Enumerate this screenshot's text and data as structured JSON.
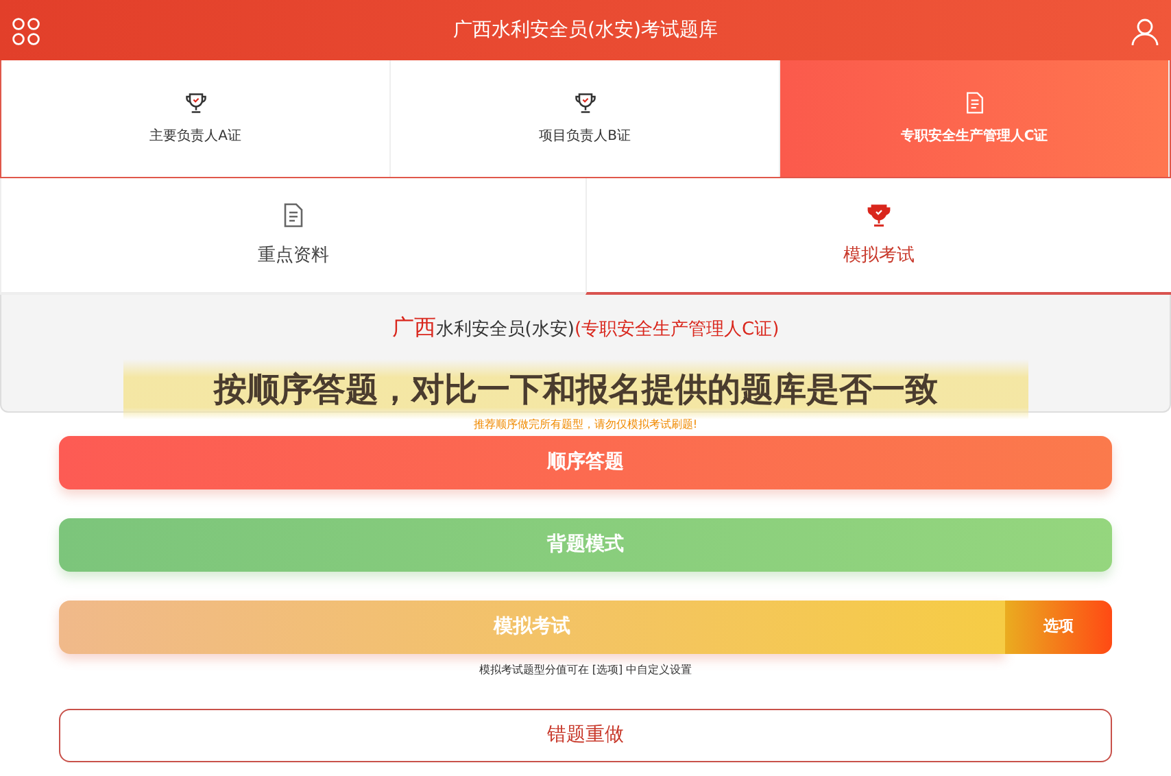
{
  "header": {
    "title": "广西水利安全员(水安)考试题库"
  },
  "cert_tabs": [
    {
      "label": "主要负责人A证",
      "kind": "trophy",
      "selected": false
    },
    {
      "label": "项目负责人B证",
      "kind": "trophy",
      "selected": false
    },
    {
      "label": "专职安全生产管理人C证",
      "kind": "doc",
      "selected": true
    }
  ],
  "section_tabs": [
    {
      "label": "重点资料",
      "kind": "doc",
      "selected": false
    },
    {
      "label": "模拟考试",
      "kind": "trophy",
      "selected": true
    }
  ],
  "info": {
    "parts": [
      {
        "text": "广西",
        "kind": "region"
      },
      {
        "text": "水利安全员(水安)",
        "kind": "plain"
      },
      {
        "text": "(专职安全生产管理人C证)",
        "kind": "cert"
      }
    ]
  },
  "annotation": "按顺序答题，对比一下和报名提供的题库是否一致",
  "hint": "推荐顺序做完所有题型，请勿仅模拟考试刷题!",
  "actions": [
    {
      "label": "顺序答题",
      "kind": "sequence"
    },
    {
      "label": "背题模式",
      "kind": "study"
    },
    {
      "label": "模拟考试",
      "kind": "exam",
      "option": "选项",
      "note": "模拟考试题型分值可在 [选项] 中自定义设置"
    },
    {
      "label": "错题重做",
      "kind": "retry"
    }
  ]
}
